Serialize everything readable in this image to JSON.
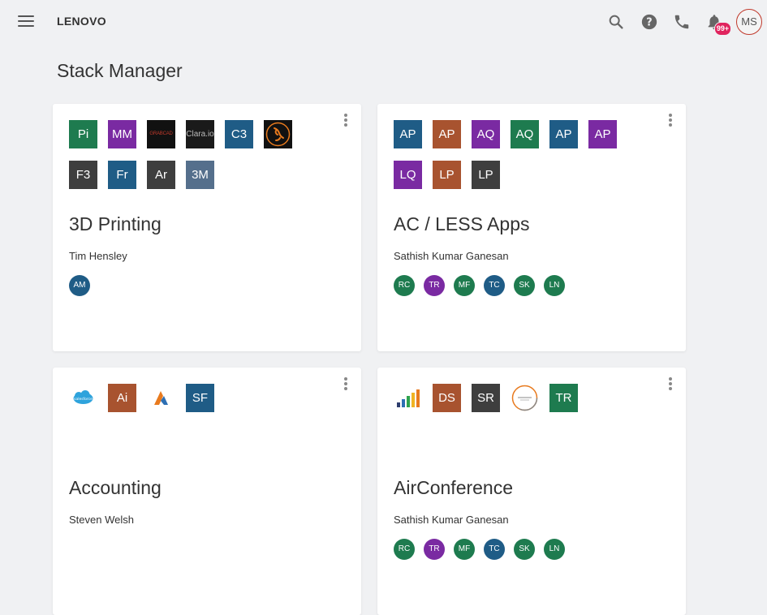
{
  "header": {
    "brand": "LENOVO",
    "notification_count": "99+",
    "user_initials": "MS",
    "icons": [
      "menu-icon",
      "search-icon",
      "help-icon",
      "phone-icon",
      "bell-icon"
    ]
  },
  "page": {
    "title": "Stack Manager"
  },
  "colors": {
    "green": "#1e7b4f",
    "purple": "#7a2aa2",
    "navy": "#1f5c86",
    "dark": "#3e3e3e",
    "rust": "#a8532f",
    "slate": "#556f8c",
    "orange": "#e87a1e"
  },
  "cards": [
    {
      "title": "3D Printing",
      "owner": "Tim Hensley",
      "apps": [
        "Pi",
        "MM",
        "GRABCAD",
        "Clara.io",
        "C3",
        "gecko-logo",
        "F3",
        "Fr",
        "Ar",
        "3M"
      ],
      "members": [
        "AM"
      ]
    },
    {
      "title": "AC / LESS Apps",
      "owner": "Sathish Kumar Ganesan",
      "apps": [
        "AP",
        "AP",
        "AQ",
        "AQ",
        "AP",
        "AP",
        "LQ",
        "LP",
        "LP"
      ],
      "members": [
        "RC",
        "TR",
        "MF",
        "TC",
        "SK",
        "LN"
      ]
    },
    {
      "title": "Accounting",
      "owner": "Steven Welsh",
      "apps": [
        "salesforce-logo",
        "Ai",
        "A-logo",
        "SF"
      ],
      "members": []
    },
    {
      "title": "AirConference",
      "owner": "Sathish Kumar Ganesan",
      "apps": [
        "bar-chart-logo",
        "DS",
        "SR",
        "circle-logo",
        "TR"
      ],
      "members": [
        "RC",
        "TR",
        "MF",
        "TC",
        "SK",
        "LN"
      ]
    }
  ]
}
